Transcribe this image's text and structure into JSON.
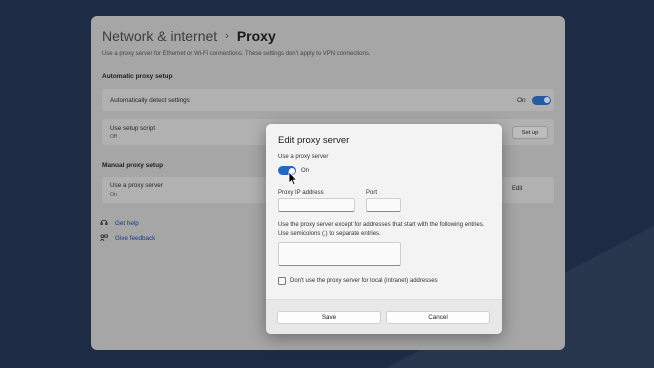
{
  "window": {
    "breadcrumb_parent": "Network & internet",
    "breadcrumb_separator": "›",
    "breadcrumb_current": "Proxy",
    "description": "Use a proxy server for Ethernet or Wi-Fi connections. These settings don't apply to VPN connections."
  },
  "automatic": {
    "section_title": "Automatic proxy setup",
    "detect_label": "Automatically detect settings",
    "detect_state": "On",
    "detect_on": true,
    "script_label": "Use setup script",
    "script_state": "Off",
    "script_button": "Set up"
  },
  "manual": {
    "section_title": "Manual proxy setup",
    "proxy_label": "Use a proxy server",
    "proxy_state": "On",
    "edit_button": "Edit"
  },
  "links": [
    {
      "label": "Get help",
      "icon": "help-icon"
    },
    {
      "label": "Give feedback",
      "icon": "feedback-icon"
    }
  ],
  "dialog": {
    "title": "Edit proxy server",
    "use_proxy_label": "Use a proxy server",
    "toggle_state": "On",
    "toggle_on": true,
    "ip_label": "Proxy IP address",
    "ip_value": "",
    "port_label": "Port",
    "port_value": "",
    "exceptions_line1": "Use the proxy server except for addresses that start with the following entries.",
    "exceptions_line2": "Use semicolons (;) to separate entries.",
    "exceptions_value": "",
    "local_checkbox_label": "Don't use the proxy server for local (intranet) addresses",
    "local_checked": false,
    "save_button": "Save",
    "cancel_button": "Cancel"
  },
  "colors": {
    "desktop_bg": "#1d2b44",
    "window_dimmed": "#a6a6a6",
    "accent": "#2767c4"
  }
}
